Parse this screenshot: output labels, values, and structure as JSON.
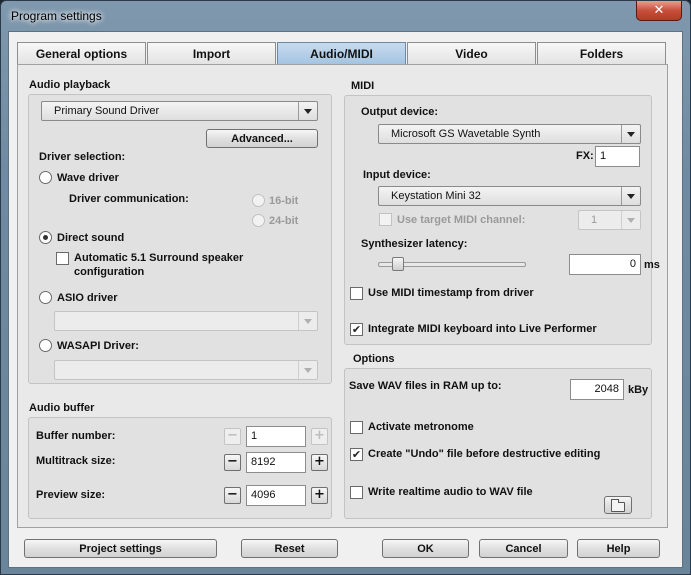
{
  "window": {
    "title": "Program settings",
    "close_glyph": "✕"
  },
  "tabs": [
    "General options",
    "Import",
    "Audio/MIDI",
    "Video",
    "Folders"
  ],
  "audio_playback": {
    "label": "Audio playback",
    "device": "Primary Sound Driver",
    "advanced_button": "Advanced...",
    "driver_selection_label": "Driver selection:",
    "wave_driver": "Wave driver",
    "driver_communication": "Driver communication:",
    "bit16": "16-bit",
    "bit24": "24-bit",
    "direct_sound": "Direct sound",
    "surround_line1": "Automatic 5.1 Surround speaker",
    "surround_line2": "configuration",
    "asio_driver": "ASIO driver",
    "wasapi_driver": "WASAPI Driver:"
  },
  "audio_buffer": {
    "label": "Audio buffer",
    "buffer_number_label": "Buffer number:",
    "buffer_number_value": "1",
    "multitrack_label": "Multitrack size:",
    "multitrack_value": "8192",
    "preview_label": "Preview size:",
    "preview_value": "4096",
    "minus": "−",
    "plus": "+"
  },
  "midi": {
    "label": "MIDI",
    "output_label": "Output device:",
    "output_device": "Microsoft GS Wavetable Synth",
    "fx_label": "FX:",
    "fx_value": "1",
    "input_label": "Input device:",
    "input_device": "Keystation Mini 32",
    "target_channel_label": "Use target MIDI channel:",
    "target_channel_value": "1",
    "latency_label": "Synthesizer latency:",
    "latency_value": "0",
    "latency_unit": "ms",
    "latency_level": 0.1,
    "timestamp_label": "Use MIDI timestamp from driver",
    "integrate_label": "Integrate MIDI keyboard into Live Performer",
    "check_glyph": "✔"
  },
  "options": {
    "label": "Options",
    "save_wav_label": "Save WAV files in RAM up to:",
    "save_wav_value": "2048",
    "save_wav_unit": "kBy",
    "metronome_label": "Activate metronome",
    "undo_label": "Create \"Undo\" file before destructive editing",
    "realtime_label": "Write realtime audio to WAV file"
  },
  "footer": {
    "project_settings": "Project settings",
    "reset": "Reset",
    "ok": "OK",
    "cancel": "Cancel",
    "help": "Help"
  }
}
